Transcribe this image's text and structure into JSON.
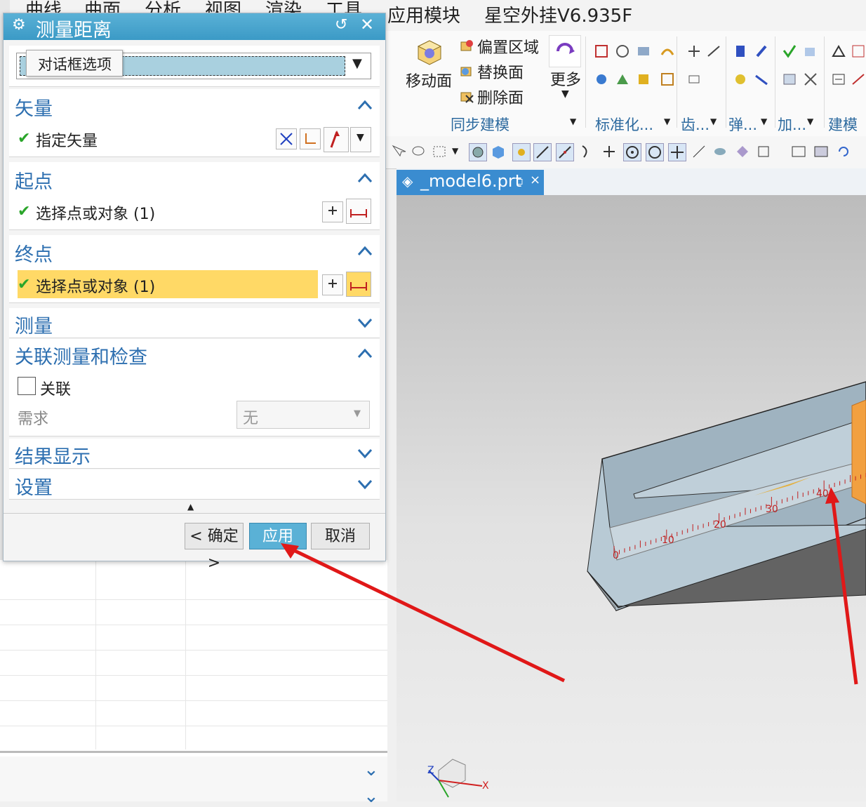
{
  "menubar": {
    "items": [
      "曲线",
      "曲面",
      "分析",
      "视图",
      "渲染",
      "工具",
      "应用模块",
      "星空外挂V6.935F"
    ]
  },
  "ribbon": {
    "move_face": "移动面",
    "offset_region": "偏置区域",
    "replace_face": "替换面",
    "delete_face": "删除面",
    "more": "更多",
    "groups": [
      "同步建模",
      "标准化...",
      "齿...",
      "弹...",
      "加...",
      "建模工"
    ]
  },
  "graphics": {
    "tab_label": "_model6.prt",
    "ruler_labels": [
      "0",
      "10",
      "20",
      "30",
      "40"
    ],
    "axis_x": "X",
    "axis_z": "Z"
  },
  "dialog": {
    "title": "测量距离",
    "type_tooltip": "对话框选项",
    "sections": {
      "vector": {
        "title": "矢量",
        "row": "指定矢量"
      },
      "start": {
        "title": "起点",
        "row": "选择点或对象 (1)"
      },
      "end": {
        "title": "终点",
        "row": "选择点或对象 (1)"
      },
      "measure": {
        "title": "测量"
      },
      "assoc": {
        "title": "关联测量和检查",
        "checkbox": "关联",
        "req_label": "需求",
        "req_value": "无"
      },
      "result": {
        "title": "结果显示"
      },
      "settings": {
        "title": "设置"
      }
    },
    "buttons": {
      "ok": "< 确定 >",
      "apply": "应用",
      "cancel": "取消"
    }
  },
  "colors": {
    "title_bar": "#3b9ac6",
    "section_title": "#2d6fb0",
    "highlight_row": "#ffd966",
    "apply_button": "#5ab1d6",
    "arrow": "#e01818"
  }
}
